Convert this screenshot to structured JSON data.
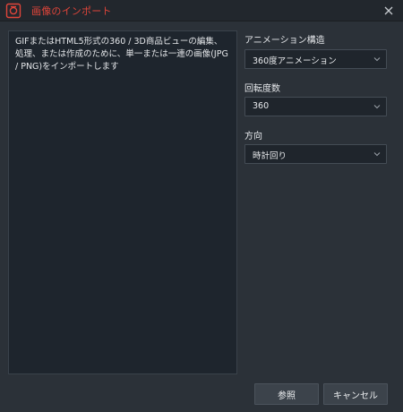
{
  "window": {
    "title": "画像のインポート",
    "accent_color": "#e0453a"
  },
  "icons": {
    "logo": "app-logo-icon",
    "close": "close-icon",
    "dropdown": "chevron-down-icon"
  },
  "description": "GIFまたはHTML5形式の360 / 3D商品ビューの編集、処理、または作成のために、単一または一連の画像(JPG / PNG)をインポートします",
  "settings": {
    "animation_structure": {
      "label": "アニメーション構造",
      "value": "360度アニメーション"
    },
    "rotation_degrees": {
      "label": "回転度数",
      "value": "360"
    },
    "direction": {
      "label": "方向",
      "value": "時計回り"
    }
  },
  "buttons": {
    "browse": "参照",
    "cancel": "キャンセル"
  }
}
